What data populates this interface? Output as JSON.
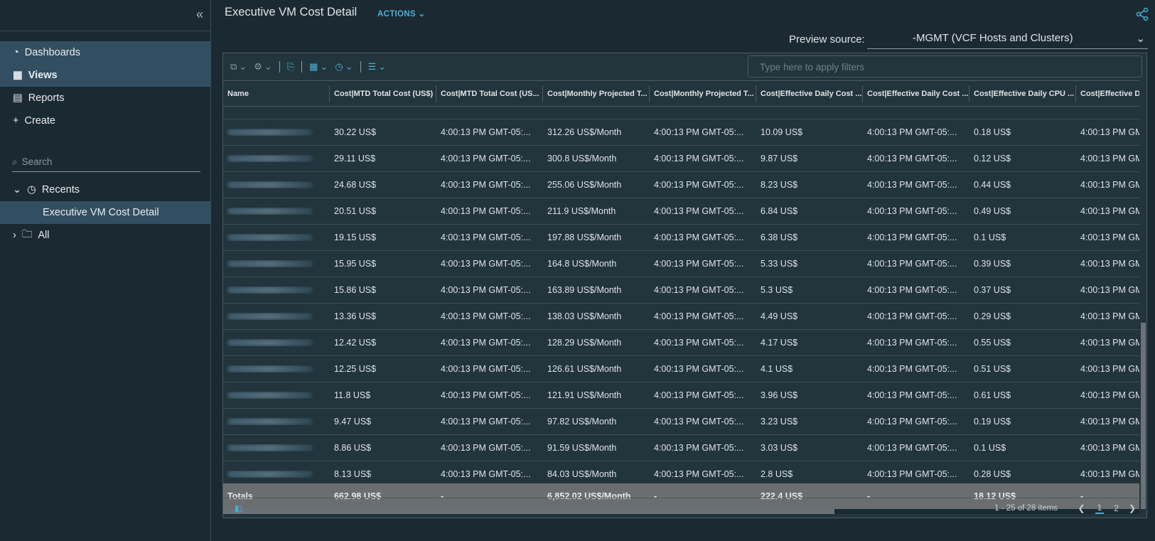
{
  "sidebar": {
    "items": [
      {
        "label": "Dashboards",
        "icon": "dashboard-icon"
      },
      {
        "label": "Views",
        "icon": "views-icon"
      },
      {
        "label": "Reports",
        "icon": "reports-icon"
      },
      {
        "label": "Create",
        "icon": "plus-icon"
      }
    ],
    "search_placeholder": "Search",
    "recents_label": "Recents",
    "recent_item": "Executive VM Cost Detail",
    "all_label": "All"
  },
  "header": {
    "title": "Executive VM Cost Detail",
    "actions_label": "ACTIONS"
  },
  "preview": {
    "label": "Preview source:",
    "value": "-MGMT (VCF Hosts and Clusters)"
  },
  "filter_placeholder": "Type here to apply filters",
  "columns": [
    "Name",
    "Cost|MTD Total Cost (US$)",
    "Cost|MTD Total Cost (US...",
    "Cost|Monthly Projected T...",
    "Cost|Monthly Projected T...",
    "Cost|Effective Daily Cost ...",
    "Cost|Effective Daily Cost ...",
    "Cost|Effective Daily CPU ...",
    "Cost|Effective Daily"
  ],
  "rows": [
    [
      "",
      "30.22 US$",
      "4:00:13 PM GMT-05:...",
      "312.26 US$/Month",
      "4:00:13 PM GMT-05:...",
      "10.09 US$",
      "4:00:13 PM GMT-05:...",
      "0.18 US$",
      "4:00:13 PM GM"
    ],
    [
      "",
      "29.11 US$",
      "4:00:13 PM GMT-05:...",
      "300.8 US$/Month",
      "4:00:13 PM GMT-05:...",
      "9.87 US$",
      "4:00:13 PM GMT-05:...",
      "0.12 US$",
      "4:00:13 PM GM"
    ],
    [
      "",
      "24.68 US$",
      "4:00:13 PM GMT-05:...",
      "255.06 US$/Month",
      "4:00:13 PM GMT-05:...",
      "8.23 US$",
      "4:00:13 PM GMT-05:...",
      "0.44 US$",
      "4:00:13 PM GM"
    ],
    [
      "",
      "20.51 US$",
      "4:00:13 PM GMT-05:...",
      "211.9 US$/Month",
      "4:00:13 PM GMT-05:...",
      "6.84 US$",
      "4:00:13 PM GMT-05:...",
      "0.49 US$",
      "4:00:13 PM GM"
    ],
    [
      "",
      "19.15 US$",
      "4:00:13 PM GMT-05:...",
      "197.88 US$/Month",
      "4:00:13 PM GMT-05:...",
      "6.38 US$",
      "4:00:13 PM GMT-05:...",
      "0.1 US$",
      "4:00:13 PM GM"
    ],
    [
      "",
      "15.95 US$",
      "4:00:13 PM GMT-05:...",
      "164.8 US$/Month",
      "4:00:13 PM GMT-05:...",
      "5.33 US$",
      "4:00:13 PM GMT-05:...",
      "0.39 US$",
      "4:00:13 PM GM"
    ],
    [
      "",
      "15.86 US$",
      "4:00:13 PM GMT-05:...",
      "163.89 US$/Month",
      "4:00:13 PM GMT-05:...",
      "5.3 US$",
      "4:00:13 PM GMT-05:...",
      "0.37 US$",
      "4:00:13 PM GM"
    ],
    [
      "",
      "13.36 US$",
      "4:00:13 PM GMT-05:...",
      "138.03 US$/Month",
      "4:00:13 PM GMT-05:...",
      "4.49 US$",
      "4:00:13 PM GMT-05:...",
      "0.29 US$",
      "4:00:13 PM GM"
    ],
    [
      "",
      "12.42 US$",
      "4:00:13 PM GMT-05:...",
      "128.29 US$/Month",
      "4:00:13 PM GMT-05:...",
      "4.17 US$",
      "4:00:13 PM GMT-05:...",
      "0.55 US$",
      "4:00:13 PM GM"
    ],
    [
      "",
      "12.25 US$",
      "4:00:13 PM GMT-05:...",
      "126.61 US$/Month",
      "4:00:13 PM GMT-05:...",
      "4.1 US$",
      "4:00:13 PM GMT-05:...",
      "0.51 US$",
      "4:00:13 PM GM"
    ],
    [
      "",
      "11.8 US$",
      "4:00:13 PM GMT-05:...",
      "121.91 US$/Month",
      "4:00:13 PM GMT-05:...",
      "3.96 US$",
      "4:00:13 PM GMT-05:...",
      "0.61 US$",
      "4:00:13 PM GM"
    ],
    [
      "",
      "9.47 US$",
      "4:00:13 PM GMT-05:...",
      "97.82 US$/Month",
      "4:00:13 PM GMT-05:...",
      "3.23 US$",
      "4:00:13 PM GMT-05:...",
      "0.19 US$",
      "4:00:13 PM GM"
    ],
    [
      "",
      "8.86 US$",
      "4:00:13 PM GMT-05:...",
      "91.59 US$/Month",
      "4:00:13 PM GMT-05:...",
      "3.03 US$",
      "4:00:13 PM GMT-05:...",
      "0.1 US$",
      "4:00:13 PM GM"
    ],
    [
      "",
      "8.13 US$",
      "4:00:13 PM GMT-05:...",
      "84.03 US$/Month",
      "4:00:13 PM GMT-05:...",
      "2.8 US$",
      "4:00:13 PM GMT-05:...",
      "0.28 US$",
      "4:00:13 PM GM"
    ]
  ],
  "totals": [
    "Totals",
    "662.98 US$",
    "-",
    "6,852.02 US$/Month",
    "-",
    "222.4 US$",
    "-",
    "18.12 US$",
    "-"
  ],
  "footer": {
    "count": "1 - 25 of 28 items",
    "pages": [
      "1",
      "2"
    ],
    "current_page": "1"
  },
  "colors": {
    "accent": "#49afd9",
    "background": "#1b2a32",
    "selected": "#324f61",
    "totals_bg": "#6b6e70"
  }
}
